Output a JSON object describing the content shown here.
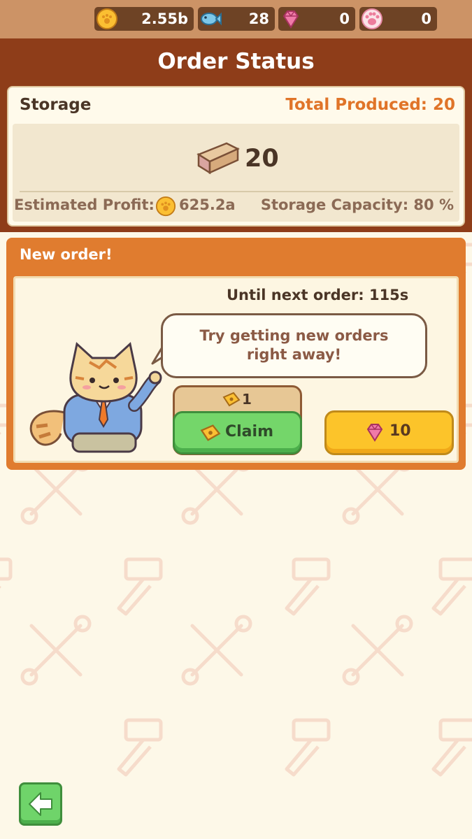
{
  "currency_bar": {
    "coins": {
      "value": "2.55b",
      "icon": "paw-coin-icon"
    },
    "fish": {
      "value": "28",
      "icon": "fish-icon"
    },
    "gems": {
      "value": "0",
      "icon": "gem-icon"
    },
    "paws": {
      "value": "0",
      "icon": "paw-icon"
    }
  },
  "header": {
    "title": "Order Status"
  },
  "storage": {
    "label": "Storage",
    "total_produced": "Total Produced: 20",
    "item_icon": "wood-plank-icon",
    "count": "20",
    "estimated_profit_label": "Estimated Profit:",
    "estimated_profit_value": "625.2a",
    "storage_capacity": "Storage Capacity: 80 %"
  },
  "order": {
    "title": "New order!",
    "timer": "Until next order: 115s",
    "message_line1": "Try getting new orders",
    "message_line2": "right away!",
    "ticket_cost": "1",
    "claim_label": "Claim",
    "gem_cost": "10"
  },
  "colors": {
    "header_brown": "#8e3d19",
    "top_bar": "#cc9366",
    "order_orange": "#e07c2f",
    "claim_green": "#74d66a",
    "gem_yellow": "#fcc42a",
    "accent_orange_text": "#e07428"
  }
}
